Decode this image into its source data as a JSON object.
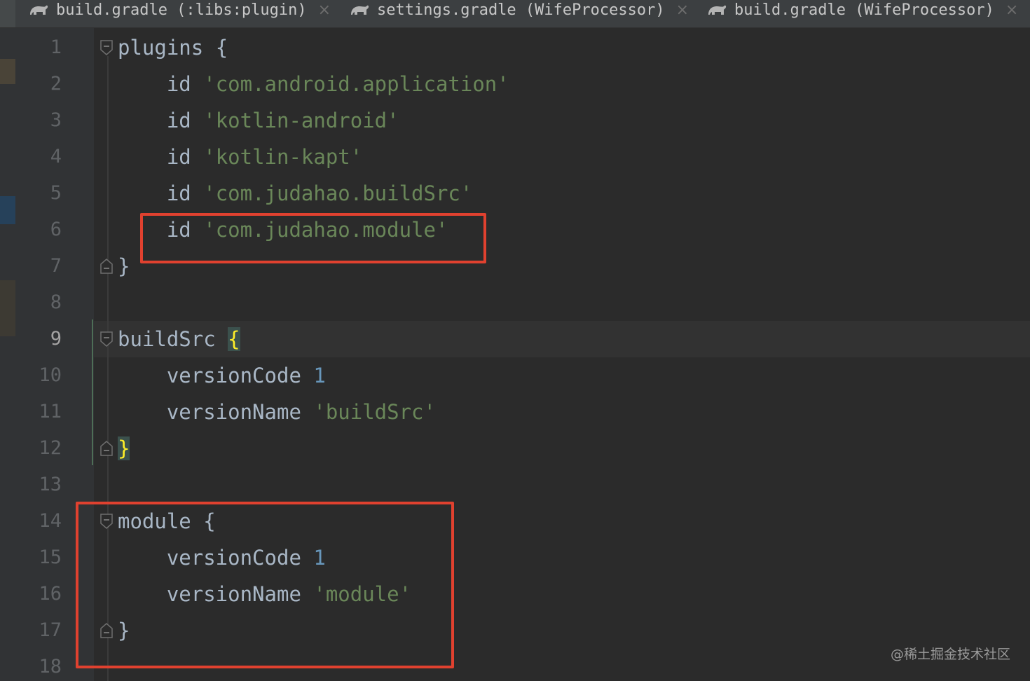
{
  "tabs": [
    {
      "label": "build.gradle (:libs:plugin)",
      "icon": "gradle-elephant-icon"
    },
    {
      "label": "settings.gradle (WifeProcessor)",
      "icon": "gradle-elephant-icon"
    },
    {
      "label": "build.gradle (WifeProcessor)",
      "icon": "gradle-elephant-icon"
    }
  ],
  "close_glyph": "×",
  "line_numbers": [
    "1",
    "2",
    "3",
    "4",
    "5",
    "6",
    "7",
    "8",
    "9",
    "10",
    "11",
    "12",
    "13",
    "14",
    "15",
    "16",
    "17",
    "18"
  ],
  "current_line": 9,
  "code": {
    "l1": {
      "name": "plugins",
      "brace": "{"
    },
    "l2": {
      "kw": "id",
      "str": "'com.android.application'"
    },
    "l3": {
      "kw": "id",
      "str": "'kotlin-android'"
    },
    "l4": {
      "kw": "id",
      "str": "'kotlin-kapt'"
    },
    "l5": {
      "kw": "id",
      "str": "'com.judahao.buildSrc'"
    },
    "l6": {
      "kw": "id",
      "str": "'com.judahao.module'"
    },
    "l7": {
      "brace": "}"
    },
    "l9": {
      "name": "buildSrc",
      "brace": "{"
    },
    "l10": {
      "kw": "versionCode",
      "num": "1"
    },
    "l11": {
      "kw": "versionName",
      "str": "'buildSrc'"
    },
    "l12": {
      "brace": "}"
    },
    "l14": {
      "name": "module",
      "brace": "{"
    },
    "l15": {
      "kw": "versionCode",
      "num": "1"
    },
    "l16": {
      "kw": "versionName",
      "str": "'module'"
    },
    "l17": {
      "brace": "}"
    }
  },
  "watermark": "@稀土掘金技术社区",
  "colors": {
    "background": "#2b2b2b",
    "gutter": "#313335",
    "string": "#6a8759",
    "number": "#6897bb",
    "identifier": "#a9b7c6",
    "brace_match": "#ffef28",
    "annotation": "#e0412f"
  }
}
